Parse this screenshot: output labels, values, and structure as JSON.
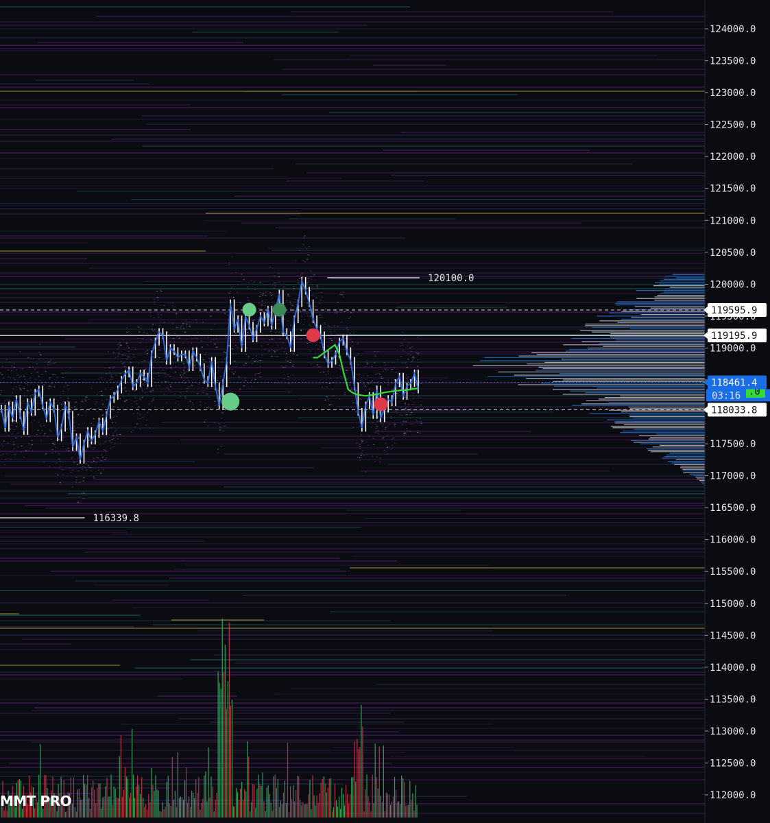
{
  "brand": "MMT PRO",
  "colors": {
    "background": "#0b0b12",
    "axis_background": "#0b0b12",
    "candles": "#ffffff",
    "trend_blue": "#2f6ee8",
    "vwap_green": "#33dd33",
    "buy_dot": "#66cc88",
    "buy_dot_dark": "#3b8a55",
    "sell_dot": "#e03a4a",
    "current_price_bg": "#1a6ee8",
    "level_label_bg": "#ffffff",
    "heatmap_purple": "#7a2a9e",
    "heatmap_teal": "#2a8f8a",
    "heatmap_yellow": "#c9b73a",
    "volume_green": "#3fbf6f",
    "volume_red": "#d8404f"
  },
  "chart_data": {
    "type": "line",
    "y_axis": {
      "side": "right",
      "range": [
        111700,
        124400
      ],
      "ticks": [
        "124000.0",
        "123500.0",
        "123000.0",
        "122500.0",
        "122000.0",
        "121500.0",
        "121000.0",
        "120500.0",
        "120000.0",
        "119500.0",
        "119000.0",
        "118500.0",
        "118000.0",
        "117500.0",
        "117000.0",
        "116500.0",
        "116000.0",
        "115500.0",
        "115000.0",
        "114500.0",
        "114000.0",
        "113500.0",
        "113000.0",
        "112500.0",
        "112000.0"
      ],
      "tick_values": [
        124000,
        123500,
        123000,
        122500,
        122000,
        121500,
        121000,
        120500,
        120000,
        119500,
        119000,
        118500,
        118000,
        117500,
        117000,
        116500,
        116000,
        115500,
        115000,
        114500,
        114000,
        113500,
        113000,
        112500,
        112000
      ]
    },
    "price_series": [
      118050,
      117750,
      118100,
      117900,
      118200,
      117950,
      117700,
      118150,
      118000,
      118300,
      118350,
      118100,
      117900,
      118150,
      118050,
      117600,
      117750,
      118100,
      117950,
      117450,
      117600,
      117250,
      117500,
      117700,
      117550,
      117650,
      117850,
      117700,
      117950,
      118200,
      118250,
      118350,
      118500,
      118600,
      118650,
      118400,
      118450,
      118600,
      118550,
      118450,
      118900,
      119100,
      119250,
      119200,
      118800,
      119000,
      118950,
      118850,
      118900,
      118900,
      118700,
      118950,
      118850,
      118700,
      118500,
      118450,
      118800,
      118400,
      118100,
      118450,
      118800,
      119700,
      119300,
      119450,
      119000,
      119500,
      119350,
      119150,
      119300,
      119500,
      119400,
      119600,
      119350,
      119600,
      119850,
      119250,
      119200,
      119000,
      119450,
      119700,
      120050,
      119900,
      119700,
      119450,
      119300,
      119200,
      118900,
      118750,
      118800,
      118900,
      119100,
      119150,
      118950,
      118800,
      118400,
      118000,
      117750,
      118100,
      118250,
      117950,
      118350,
      117900,
      118050,
      118200,
      118150,
      118450,
      118550,
      118250,
      118400,
      118450,
      118600,
      118350
    ],
    "ma_series_x_start_index": 83,
    "ma_series": [
      118850,
      118850,
      118900,
      118950,
      119000,
      119050,
      118900,
      118600,
      118350,
      118300,
      118270,
      118260,
      118250,
      118260,
      118270,
      118280,
      118300,
      118310,
      118320,
      118330,
      118340,
      118340,
      118350,
      118360,
      118370
    ],
    "levels": [
      {
        "value": 120100.0,
        "label": "120100.0",
        "x_start": 0.425,
        "x_end": 0.545
      },
      {
        "value": 116339.8,
        "label": "116339.8",
        "x_start": 0.0,
        "x_end": 0.11
      }
    ],
    "axis_badges": [
      {
        "value": 119595.9,
        "label": "119595.9",
        "style": "white",
        "line": "dashed"
      },
      {
        "value": 119195.9,
        "label": "119195.9",
        "style": "white",
        "line": "solid"
      },
      {
        "value": 118461.4,
        "label": "118461.4",
        "style": "blue",
        "line": "dotted"
      },
      {
        "value": 118033.8,
        "label": "118033.8",
        "style": "white",
        "line": "dashed"
      }
    ],
    "countdown": {
      "label": "03:16",
      "value": 118260
    },
    "partial_badge": {
      "label": ".0",
      "value": 118320
    },
    "markers": [
      {
        "xi": 61,
        "value": 118160,
        "color": "buy",
        "size": "large"
      },
      {
        "xi": 66,
        "value": 119600,
        "color": "buy",
        "size": "medium"
      },
      {
        "xi": 74,
        "value": 119600,
        "color": "buy_dark",
        "size": "medium"
      },
      {
        "xi": 83,
        "value": 119200,
        "color": "sell",
        "size": "medium"
      },
      {
        "xi": 101,
        "value": 118120,
        "color": "sell",
        "size": "medium"
      }
    ],
    "grid": false,
    "legend": "none"
  }
}
